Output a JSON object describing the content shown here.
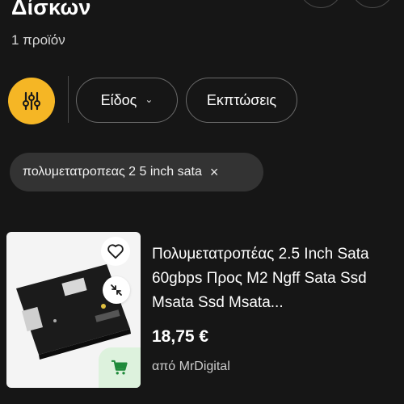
{
  "header": {
    "title": "Δίσκων",
    "count": "1 προϊόν"
  },
  "filters": {
    "filter_icon": "sliders-icon",
    "type_label": "Είδος",
    "discounts_label": "Εκπτώσεις"
  },
  "active_chip": {
    "label": "πολυμετατροπεας 2 5 inch sata",
    "remove_glyph": "×"
  },
  "product": {
    "title": "Πολυμετατροπέας 2.5 Inch Sata 60gbps Προς M2 Ngff Sata Ssd Msata Ssd Msata...",
    "price": "18,75 €",
    "seller": "από MrDigital",
    "icons": [
      "heart-icon",
      "compare-icon",
      "cart-icon"
    ]
  },
  "colors": {
    "background": "#161616",
    "accent": "#f5b625",
    "chip": "#333333",
    "cart_bg": "#ddf2dd",
    "cart_icon": "#1f8a3a"
  }
}
